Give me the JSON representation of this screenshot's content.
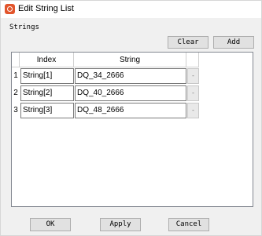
{
  "window": {
    "title": "Edit String List",
    "icon": "app-icon"
  },
  "group": {
    "label": "Strings"
  },
  "toolbar": {
    "clear_label": "Clear",
    "add_label": "Add"
  },
  "table": {
    "columns": [
      "Index",
      "String"
    ],
    "rows": [
      {
        "num": "1",
        "index": "String[1]",
        "string": "DQ_34_2666",
        "action": "-"
      },
      {
        "num": "2",
        "index": "String[2]",
        "string": "DQ_40_2666",
        "action": "-"
      },
      {
        "num": "3",
        "index": "String[3]",
        "string": "DQ_48_2666",
        "action": "-"
      }
    ]
  },
  "footer": {
    "ok_label": "OK",
    "apply_label": "Apply",
    "cancel_label": "Cancel"
  }
}
